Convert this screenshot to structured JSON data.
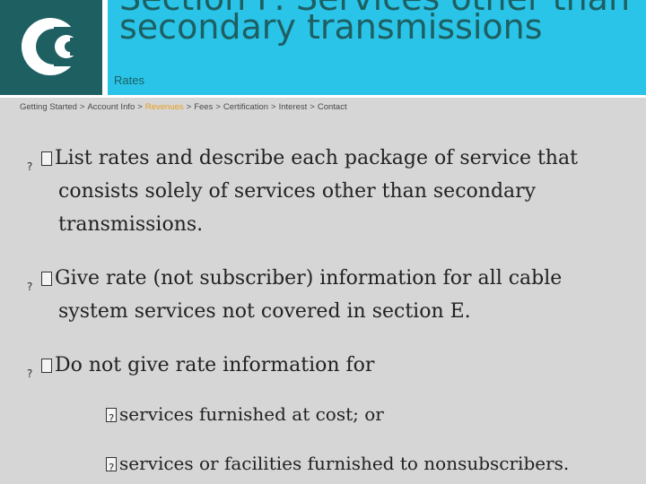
{
  "slide": {
    "title": "Section F: Services other than\nsecondary transmissions",
    "subtitle": "Rates"
  },
  "breadcrumb": {
    "items": [
      "Getting Started",
      "Account Info",
      "Revenues",
      "Fees",
      "Certification",
      "Interest",
      "Contact"
    ],
    "active": "Revenues",
    "separator": ">"
  },
  "bullets": [
    "List rates and describe each package of service that consists solely of services other than secondary transmissions.",
    "Give rate (not subscriber) information for all cable system services not covered in section E.",
    "Do not give rate information for"
  ],
  "sub_bullets": [
    "services furnished at cost; or",
    "services or facilities furnished to nonsubscribers."
  ],
  "colors": {
    "header": "#29c4e8",
    "logo_bg": "#1e5f62",
    "title": "#1e5f62",
    "active_crumb": "#e8a020",
    "background": "#d6d6d6"
  }
}
